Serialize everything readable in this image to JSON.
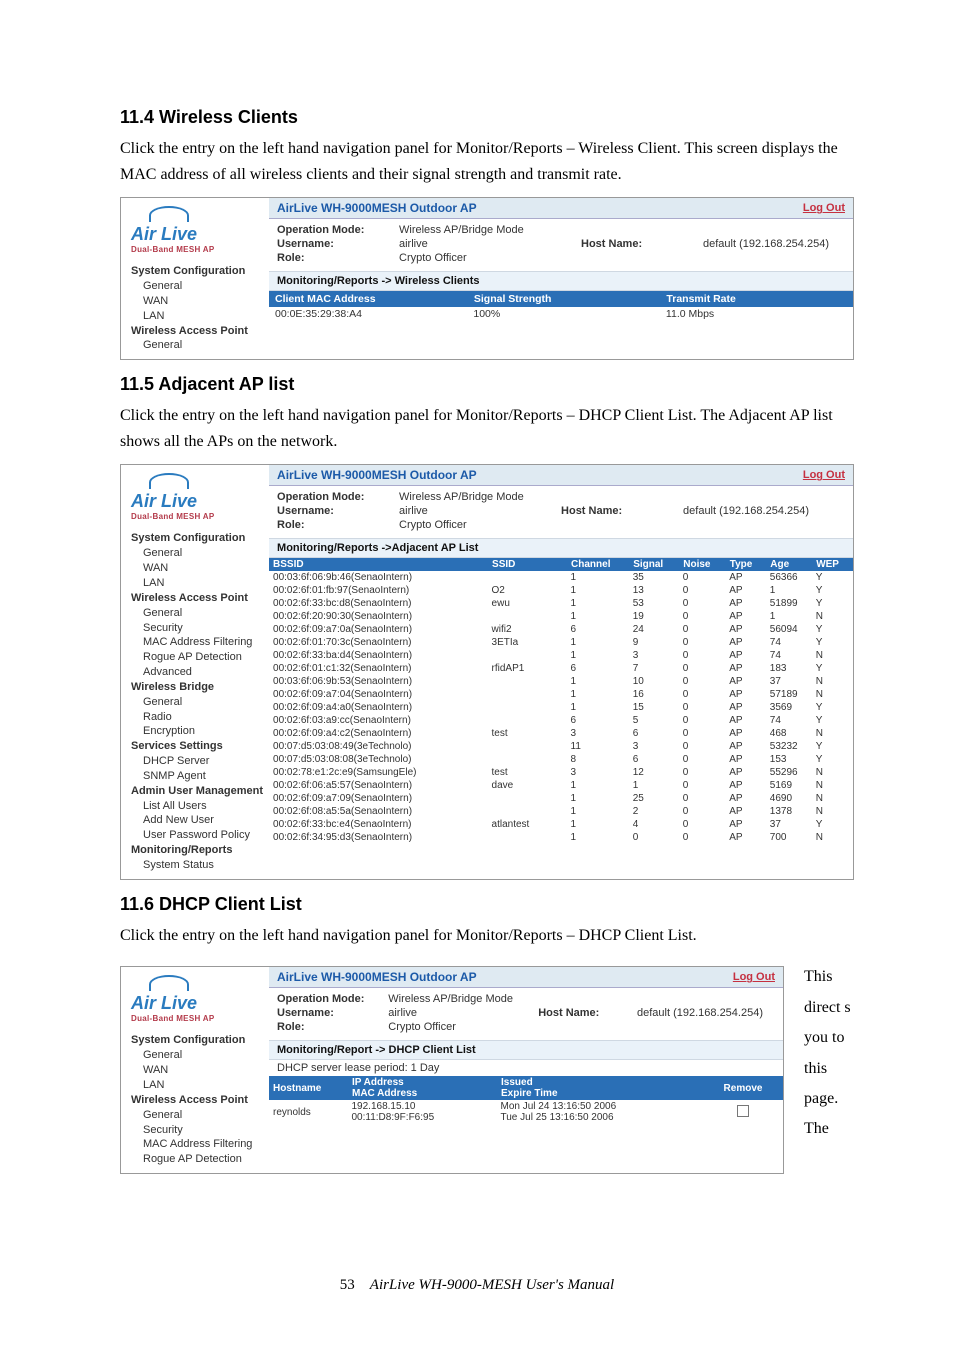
{
  "headings": {
    "h4": "11.4 Wireless Clients",
    "h5": "11.5 Adjacent AP list",
    "h6": "11.6 DHCP Client List"
  },
  "paras": {
    "p4": "Click the entry on the left hand navigation panel for Monitor/Reports – Wireless Client. This screen displays the MAC address of all wireless clients and their signal strength and transmit rate.",
    "p5": "Click the entry on the left hand navigation panel for Monitor/Reports – DHCP Client List. The Adjacent AP list shows all the APs on the network.",
    "p6": "Click the entry on the left hand navigation panel for Monitor/Reports – DHCP Client List.",
    "p6_right": "This direct s you to this page. The"
  },
  "panelCommon": {
    "deviceTitle": "AirLive WH-9000MESH Outdoor AP",
    "logOut": "Log Out",
    "opModeLbl": "Operation Mode:",
    "opMode": "Wireless AP/Bridge Mode",
    "userLbl": "Username:",
    "user": "airlive",
    "roleLbl": "Role:",
    "role": "Crypto Officer",
    "hostLbl": "Host Name:",
    "host": "default (192.168.254.254)",
    "logoMain": "Air Live",
    "logoSub": "Dual-Band MESH AP"
  },
  "nav1": {
    "grp0": "System Configuration",
    "i0": "General",
    "i1": "WAN",
    "i2": "LAN",
    "grp1": "Wireless Access Point",
    "i3": "General"
  },
  "nav2": {
    "grp0": "System Configuration",
    "i0": "General",
    "i1": "WAN",
    "i2": "LAN",
    "grp1": "Wireless Access Point",
    "i3": "General",
    "i4": "Security",
    "i5": "MAC Address Filtering",
    "i6": "Rogue AP Detection",
    "i7": "Advanced",
    "grp2": "Wireless Bridge",
    "i8": "General",
    "i9": "Radio",
    "i10": "Encryption",
    "grp3": "Services Settings",
    "i11": "DHCP Server",
    "i12": "SNMP Agent",
    "grp4": "Admin User Management",
    "i13": "List All Users",
    "i14": "Add New User",
    "i15": "User Password Policy",
    "grp5": "Monitoring/Reports",
    "i16": "System Status"
  },
  "nav3": {
    "grp0": "System Configuration",
    "i0": "General",
    "i1": "WAN",
    "i2": "LAN",
    "grp1": "Wireless Access Point",
    "i3": "General",
    "i4": "Security",
    "i5": "MAC Address Filtering",
    "i6": "Rogue AP Detection"
  },
  "panel1": {
    "crumb": "Monitoring/Reports -> Wireless Clients",
    "th0": "Client MAC Address",
    "th1": "Signal Strength",
    "th2": "Transmit Rate",
    "r0c0": "00:0E:35:29:38:A4",
    "r0c1": "100%",
    "r0c2": "11.0 Mbps"
  },
  "panel2": {
    "crumb": "Monitoring/Reports ->Adjacent AP List",
    "th0": "BSSID",
    "th1": "SSID",
    "th2": "Channel",
    "th3": "Signal",
    "th4": "Noise",
    "th5": "Type",
    "th6": "Age",
    "th7": "WEP"
  },
  "aplist": [
    {
      "b": "00:03:6f:06:9b:46(SenaoIntern)",
      "s": "",
      "c": "1",
      "sig": "35",
      "n": "0",
      "t": "AP",
      "a": "56366",
      "w": "Y"
    },
    {
      "b": "00:02:6f:01:fb:97(SenaoIntern)",
      "s": "O2",
      "c": "1",
      "sig": "13",
      "n": "0",
      "t": "AP",
      "a": "1",
      "w": "Y"
    },
    {
      "b": "00:02:6f:33:bc:d8(SenaoIntern)",
      "s": "ewu",
      "c": "1",
      "sig": "53",
      "n": "0",
      "t": "AP",
      "a": "51899",
      "w": "Y"
    },
    {
      "b": "00:02:6f:20:90:30(SenaoIntern)",
      "s": "",
      "c": "1",
      "sig": "19",
      "n": "0",
      "t": "AP",
      "a": "1",
      "w": "N"
    },
    {
      "b": "00:02:6f:09:a7:0a(SenaoIntern)",
      "s": "wifi2",
      "c": "6",
      "sig": "24",
      "n": "0",
      "t": "AP",
      "a": "56094",
      "w": "Y"
    },
    {
      "b": "00:02:6f:01:70:3c(SenaoIntern)",
      "s": "3ETIa",
      "c": "1",
      "sig": "9",
      "n": "0",
      "t": "AP",
      "a": "74",
      "w": "Y"
    },
    {
      "b": "00:02:6f:33:ba:d4(SenaoIntern)",
      "s": "",
      "c": "1",
      "sig": "3",
      "n": "0",
      "t": "AP",
      "a": "74",
      "w": "N"
    },
    {
      "b": "00:02:6f:01:c1:32(SenaoIntern)",
      "s": "rfidAP1",
      "c": "6",
      "sig": "7",
      "n": "0",
      "t": "AP",
      "a": "183",
      "w": "Y"
    },
    {
      "b": "00:03:6f:06:9b:53(SenaoIntern)",
      "s": "",
      "c": "1",
      "sig": "10",
      "n": "0",
      "t": "AP",
      "a": "37",
      "w": "N"
    },
    {
      "b": "00:02:6f:09:a7:04(SenaoIntern)",
      "s": "",
      "c": "1",
      "sig": "16",
      "n": "0",
      "t": "AP",
      "a": "57189",
      "w": "N"
    },
    {
      "b": "00:02:6f:09:a4:a0(SenaoIntern)",
      "s": "",
      "c": "1",
      "sig": "15",
      "n": "0",
      "t": "AP",
      "a": "3569",
      "w": "Y"
    },
    {
      "b": "00:02:6f:03:a9:cc(SenaoIntern)",
      "s": "",
      "c": "6",
      "sig": "5",
      "n": "0",
      "t": "AP",
      "a": "74",
      "w": "Y"
    },
    {
      "b": "00:02:6f:09:a4:c2(SenaoIntern)",
      "s": "test",
      "c": "3",
      "sig": "6",
      "n": "0",
      "t": "AP",
      "a": "468",
      "w": "N"
    },
    {
      "b": "00:07:d5:03:08:49(3eTechnolo)",
      "s": "",
      "c": "11",
      "sig": "3",
      "n": "0",
      "t": "AP",
      "a": "53232",
      "w": "Y"
    },
    {
      "b": "00:07:d5:03:08:08(3eTechnolo)",
      "s": "",
      "c": "8",
      "sig": "6",
      "n": "0",
      "t": "AP",
      "a": "153",
      "w": "Y"
    },
    {
      "b": "00:02:78:e1:2c:e9(SamsungEle)",
      "s": "test",
      "c": "3",
      "sig": "12",
      "n": "0",
      "t": "AP",
      "a": "55296",
      "w": "N"
    },
    {
      "b": "00:02:6f:06:a5:57(SenaoIntern)",
      "s": "dave",
      "c": "1",
      "sig": "1",
      "n": "0",
      "t": "AP",
      "a": "5169",
      "w": "N"
    },
    {
      "b": "00:02:6f:09:a7:09(SenaoIntern)",
      "s": "",
      "c": "1",
      "sig": "25",
      "n": "0",
      "t": "AP",
      "a": "4690",
      "w": "N"
    },
    {
      "b": "00:02:6f:08:a5:5a(SenaoIntern)",
      "s": "",
      "c": "1",
      "sig": "2",
      "n": "0",
      "t": "AP",
      "a": "1378",
      "w": "N"
    },
    {
      "b": "00:02:6f:33:bc:e4(SenaoIntern)",
      "s": "atlantest",
      "c": "1",
      "sig": "4",
      "n": "0",
      "t": "AP",
      "a": "37",
      "w": "Y"
    },
    {
      "b": "00:02:6f:34:95:d3(SenaoIntern)",
      "s": "",
      "c": "1",
      "sig": "0",
      "n": "0",
      "t": "AP",
      "a": "700",
      "w": "N"
    }
  ],
  "panel3": {
    "crumb": "Monitoring/Report -> DHCP Client List",
    "lease": "DHCP server lease period: 1 Day",
    "th0": "Hostname",
    "th1a": "IP Address",
    "th1b": "MAC Address",
    "th2a": "Issued",
    "th2b": "Expire Time",
    "th3": "Remove",
    "r0c0": "reynolds",
    "r0c1a": "192.168.15.10",
    "r0c1b": "00:11:D8:9F:F6:95",
    "r0c2a": "Mon Jul 24 13:16:50 2006",
    "r0c2b": "Tue Jul 25 13:16:50 2006"
  },
  "footer": {
    "page": "53",
    "title": "AirLive WH-9000-MESH User's Manual"
  }
}
